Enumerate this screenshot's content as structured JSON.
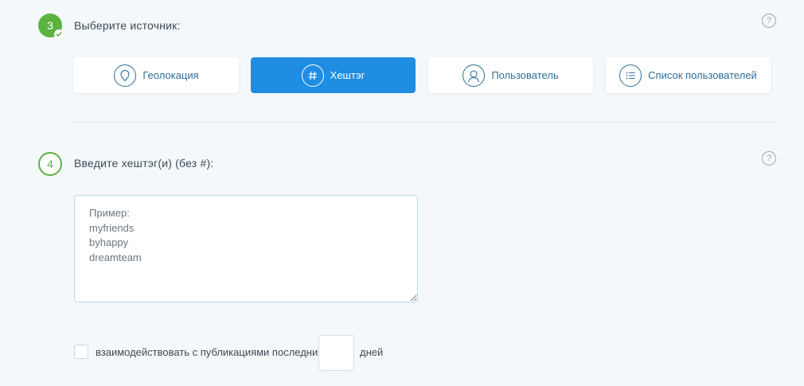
{
  "step3": {
    "number": "3",
    "title": "Выберите источник:",
    "help": "?",
    "sources": [
      {
        "label": "Геолокация",
        "icon": "location-pin-icon"
      },
      {
        "label": "Хештэг",
        "icon": "hashtag-icon",
        "active": true
      },
      {
        "label": "Пользователь",
        "icon": "user-icon"
      },
      {
        "label": "Список пользователей",
        "icon": "list-icon"
      }
    ]
  },
  "step4": {
    "number": "4",
    "title": "Введите хештэг(и) (без #):",
    "help": "?",
    "textarea_placeholder": "Пример:\nmyfriends\nbyhappy\ndreamteam"
  },
  "filter": {
    "checkbox_label": "взаимодействовать с публикациями последних",
    "days_value": "",
    "days_suffix": "дней"
  },
  "colors": {
    "accent": "#1f8de2",
    "success": "#5bb23f",
    "background": "#f4f8fb",
    "text": "#3d4a55"
  }
}
